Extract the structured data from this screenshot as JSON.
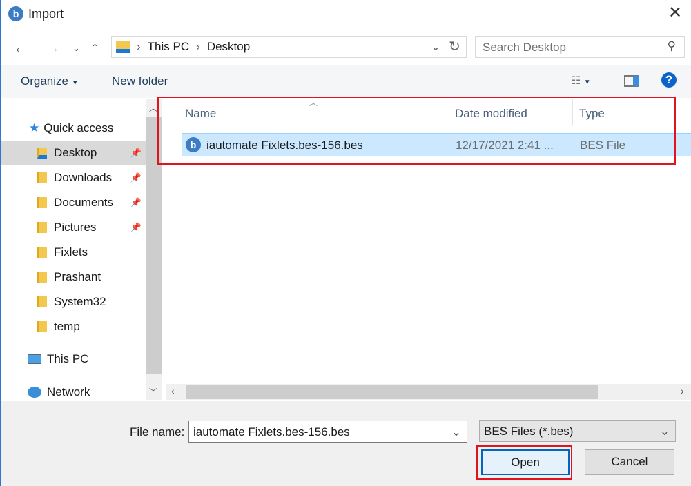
{
  "window": {
    "title": "Import",
    "close_icon": "close-icon"
  },
  "address": {
    "path": [
      "This PC",
      "Desktop"
    ]
  },
  "search": {
    "placeholder": "Search Desktop"
  },
  "toolbar": {
    "organize": "Organize",
    "new_folder": "New folder"
  },
  "sidebar": {
    "items": [
      {
        "label": "Quick access",
        "type": "quick"
      },
      {
        "label": "Desktop",
        "pinned": true,
        "selected": true
      },
      {
        "label": "Downloads",
        "pinned": true
      },
      {
        "label": "Documents",
        "pinned": true
      },
      {
        "label": "Pictures",
        "pinned": true
      },
      {
        "label": "Fixlets"
      },
      {
        "label": "Prashant"
      },
      {
        "label": "System32"
      },
      {
        "label": "temp"
      },
      {
        "label": "This PC",
        "type": "pc"
      },
      {
        "label": "Network",
        "type": "network"
      }
    ]
  },
  "columns": {
    "name": "Name",
    "date": "Date modified",
    "type": "Type"
  },
  "files": [
    {
      "name": "iautomate Fixlets.bes-156.bes",
      "date": "12/17/2021 2:41 ...",
      "type": "BES File"
    }
  ],
  "footer": {
    "file_name_label": "File name:",
    "file_name_value": "iautomate Fixlets.bes-156.bes",
    "filter": "BES Files (*.bes)",
    "open": "Open",
    "cancel": "Cancel"
  },
  "colors": {
    "selection": "#cce8ff",
    "highlight": "#e0141e",
    "accent": "#0067c0"
  }
}
